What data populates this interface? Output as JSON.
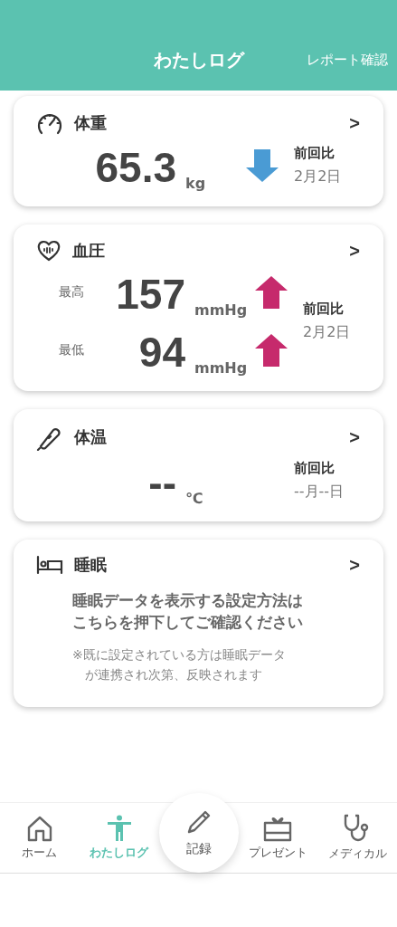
{
  "header": {
    "title": "わたしログ",
    "action": "レポート確認"
  },
  "cards": [
    {
      "kind": "weight",
      "title": "体重",
      "chevron": ">",
      "rows": [
        {
          "value": "65.3",
          "unit": "kg",
          "increase": false
        }
      ],
      "compare": {
        "label": "前回比",
        "date": "2月2日"
      }
    },
    {
      "kind": "blood_pressure",
      "title": "血圧",
      "chevron": ">",
      "rows": [
        {
          "label": "最高",
          "value": "157",
          "unit": "mmHg",
          "increase": true
        },
        {
          "label": "最低",
          "value": "94",
          "unit": "mmHg",
          "increase": true
        }
      ],
      "compare": {
        "label": "前回比",
        "date": "2月2日"
      }
    },
    {
      "kind": "temperature",
      "title": "体温",
      "chevron": ">",
      "rows": [
        {
          "value": "--",
          "unit": "℃"
        }
      ],
      "compare": {
        "label": "前回比",
        "date": "--月--日"
      }
    },
    {
      "kind": "sleep",
      "title": "睡眠",
      "chevron": ">",
      "message": [
        "睡眠データを表示する設定方法は",
        "こちらを押下してご確認ください"
      ],
      "note": [
        "※既に設定されている方は睡眠データ",
        "が連携され次第、反映されます"
      ]
    }
  ],
  "nav": [
    {
      "kind": "tab",
      "label": "ホーム",
      "selected": false
    },
    {
      "kind": "tab",
      "label": "わたしログ",
      "selected": true
    },
    {
      "kind": "raised",
      "label": "記録",
      "selected": false
    },
    {
      "kind": "tab",
      "label": "プレゼント",
      "selected": false
    },
    {
      "kind": "tab",
      "label": "メディカル",
      "selected": false
    }
  ]
}
